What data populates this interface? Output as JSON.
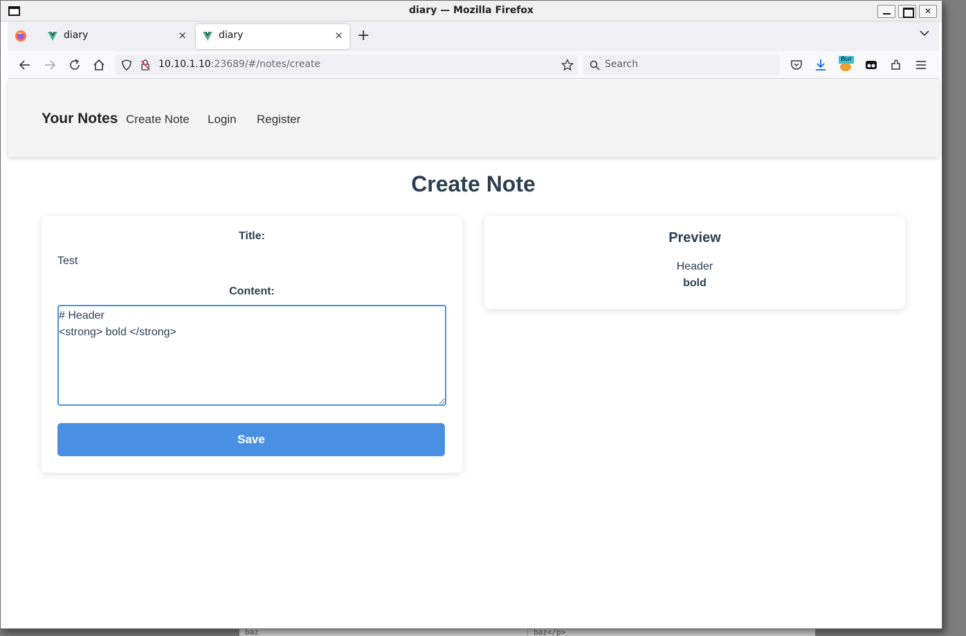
{
  "window": {
    "title": "diary — Mozilla Firefox"
  },
  "tabs": [
    {
      "label": "diary",
      "close": "×",
      "active": false
    },
    {
      "label": "diary",
      "close": "×",
      "active": true
    }
  ],
  "toolbar": {
    "new_tab": "+",
    "url_host": "10.10.1.10",
    "url_rest": ":23689/#/notes/create",
    "search_placeholder": "Search",
    "extension_badge": "Bur"
  },
  "site": {
    "brand": "Your Notes",
    "nav": [
      "Create Note",
      "Login",
      "Register"
    ]
  },
  "page": {
    "title": "Create Note",
    "form": {
      "title_label": "Title:",
      "title_value": "Test",
      "content_label": "Content:",
      "content_value": "# Header\n<strong> bold </strong>",
      "save_label": "Save"
    },
    "preview": {
      "heading": "Preview",
      "line1": "Header",
      "line2": "bold"
    }
  },
  "background": {
    "bottom_left_text": "baz",
    "bottom_right_text": "baz</p>"
  },
  "colors": {
    "accent": "#4a90e2",
    "text": "#2c3e50",
    "nav_bg": "#f4f4f4"
  }
}
